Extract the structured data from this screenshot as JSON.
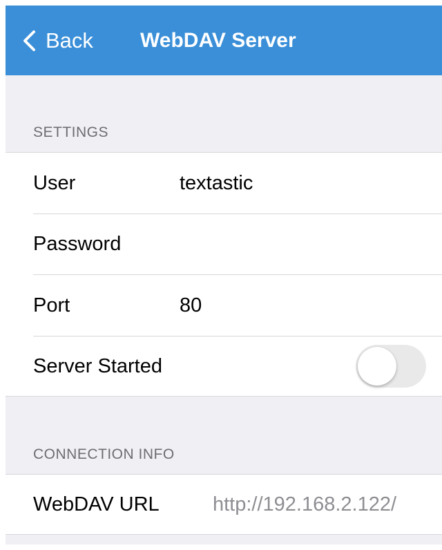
{
  "navbar": {
    "back_label": "Back",
    "title": "WebDAV Server",
    "color": "#3a8fd8"
  },
  "settings": {
    "header": "SETTINGS",
    "user_label": "User",
    "user_value": "textastic",
    "password_label": "Password",
    "password_value": "",
    "port_label": "Port",
    "port_value": "80",
    "server_started_label": "Server Started",
    "server_started_on": false
  },
  "connection_info": {
    "header": "CONNECTION INFO",
    "url_label": "WebDAV URL",
    "url_value": "http://192.168.2.122/"
  }
}
